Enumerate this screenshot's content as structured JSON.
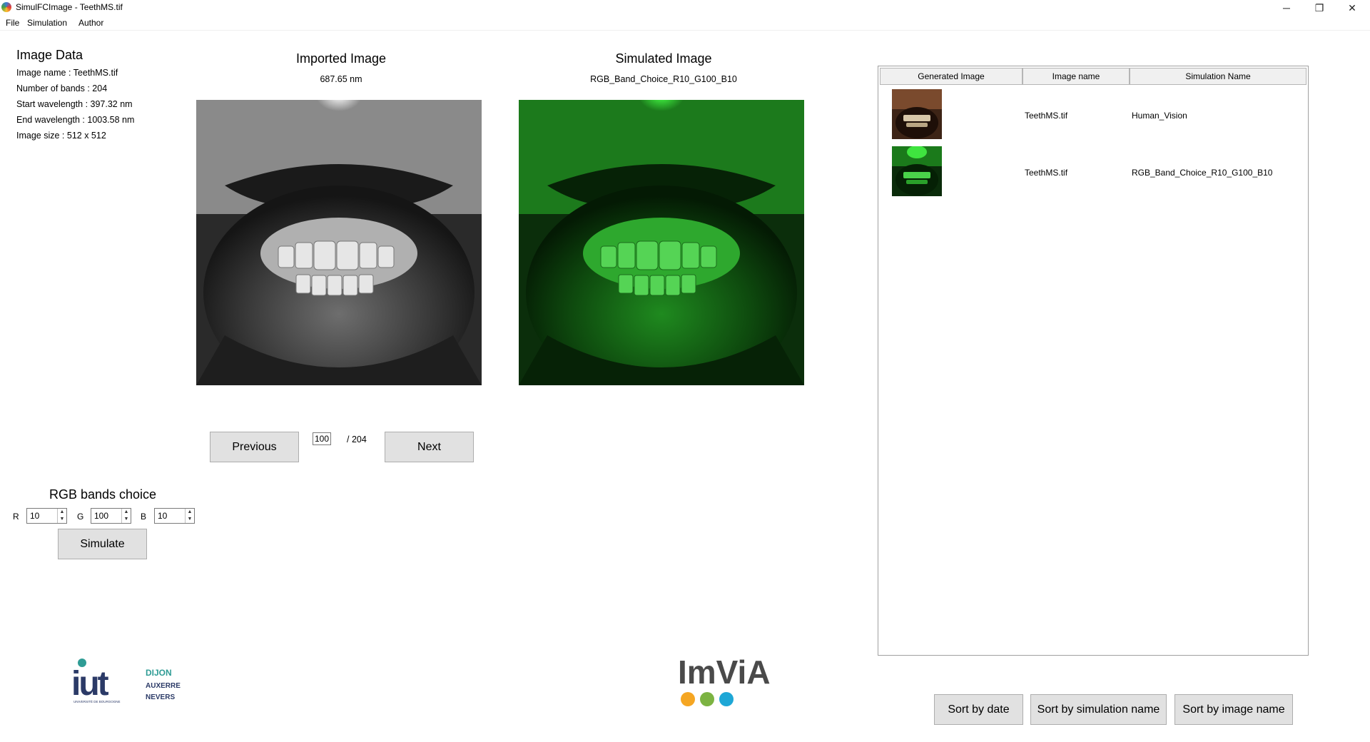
{
  "window": {
    "title": "SimulFCImage - TeethMS.tif",
    "minimize_glyph": "─",
    "maximize_glyph": "❐",
    "close_glyph": "✕"
  },
  "menu": [
    "File",
    "Simulation",
    "Author"
  ],
  "image_data": {
    "title": "Image Data",
    "lines": [
      "Image name : TeethMS.tif",
      "Number of bands : 204",
      "Start wavelength : 397.32 nm",
      "End wavelength : 1003.58 nm",
      "Image size : 512 x 512"
    ]
  },
  "imported": {
    "title": "Imported Image",
    "subtitle": "687.65 nm"
  },
  "simulated": {
    "title": "Simulated Image",
    "subtitle": "RGB_Band_Choice_R10_G100_B10"
  },
  "navigation": {
    "previous_label": "Previous",
    "next_label": "Next",
    "current_band": "100",
    "total_label": "/ 204"
  },
  "rgb_choice": {
    "title": "RGB bands choice",
    "r_label": "R",
    "g_label": "G",
    "b_label": "B",
    "r_value": "10",
    "g_value": "100",
    "b_value": "10",
    "simulate_label": "Simulate"
  },
  "table": {
    "headers": [
      "Generated Image",
      "Image name",
      "Simulation Name"
    ],
    "rows": [
      {
        "image_name": "TeethMS.tif",
        "simulation_name": "Human_Vision",
        "thumb": "natural"
      },
      {
        "image_name": "TeethMS.tif",
        "simulation_name": "RGB_Band_Choice_R10_G100_B10",
        "thumb": "green"
      }
    ]
  },
  "sort_buttons": {
    "by_date": "Sort by date",
    "by_simulation": "Sort by simulation name",
    "by_image": "Sort by image name"
  },
  "logos": {
    "iut": {
      "mark": "iut",
      "lines": [
        "DIJON",
        "AUXERRE",
        "NEVERS"
      ],
      "small": "UNIVERSITÉ DE BOURGOGNE"
    },
    "imvia": {
      "text": "ImViA",
      "dot_colors": [
        "#f5a623",
        "#7cb342",
        "#1ea7d6"
      ]
    }
  },
  "colors": {
    "button_bg": "#e1e1e1",
    "iut_teal": "#2f9c95",
    "iut_navy": "#2b3a67"
  }
}
